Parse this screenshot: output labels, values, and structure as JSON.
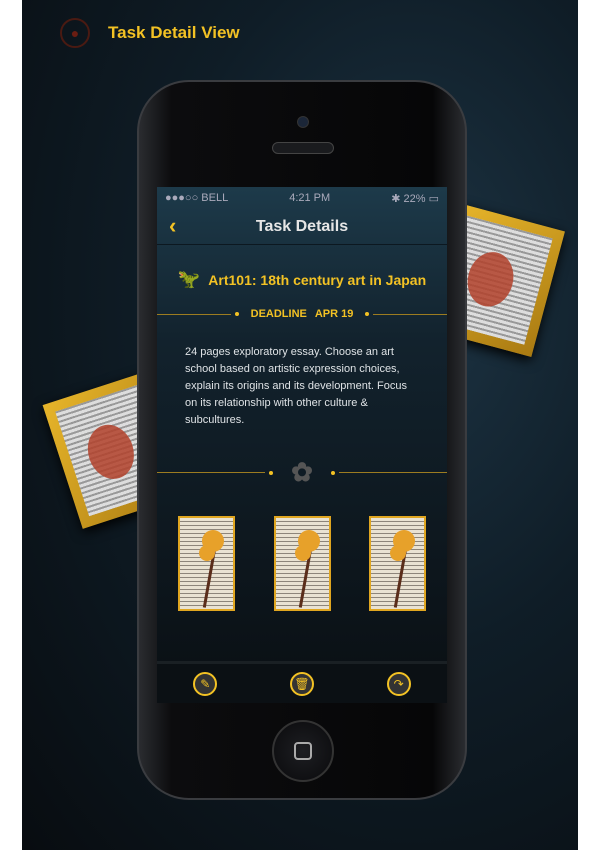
{
  "header": {
    "title": "Task Detail View",
    "icon": "eye-icon"
  },
  "status_bar": {
    "carrier": "●●●○○ BELL",
    "time": "4:21 PM",
    "battery": "22%"
  },
  "nav": {
    "title": "Task Details",
    "back": "‹"
  },
  "task": {
    "title": "Art101: 18th century art in Japan",
    "deadline_label": "DEADLINE",
    "deadline": "APR 19",
    "description": "24 pages exploratory essay. Choose an art school based on artistic expression choices, explain its origins and its development. Focus on its relationship with other culture & subcultures."
  },
  "toolbar": {
    "edit": "✎",
    "delete": "🗑",
    "share": "↷"
  },
  "colors": {
    "accent": "#f3c224"
  }
}
